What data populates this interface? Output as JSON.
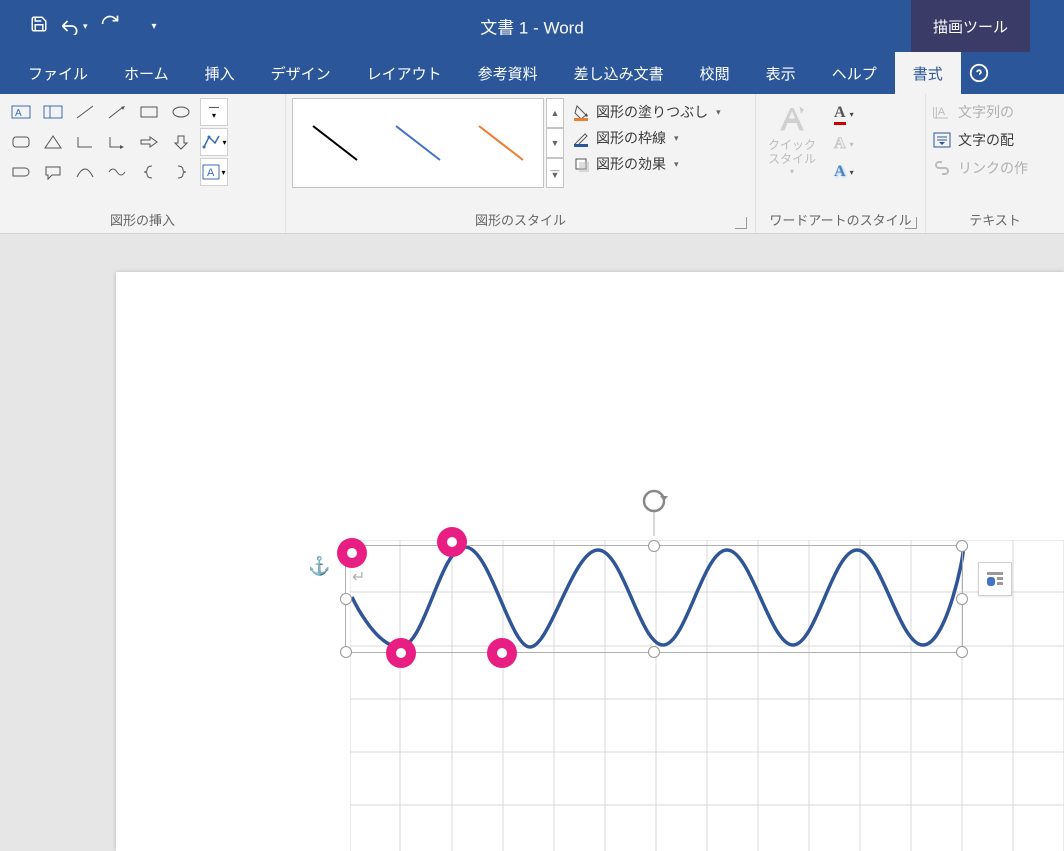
{
  "titlebar": {
    "doc_title": "文書 1",
    "app_name": "Word",
    "separator": " - ",
    "context_tab": "描画ツール"
  },
  "tabs": {
    "file": "ファイル",
    "home": "ホーム",
    "insert": "挿入",
    "design": "デザイン",
    "layout": "レイアウト",
    "references": "参考資料",
    "mailmerge": "差し込み文書",
    "review": "校閲",
    "view": "表示",
    "help": "ヘルプ",
    "format": "書式"
  },
  "groups": {
    "insert_shapes": "図形の挿入",
    "shape_styles": "図形のスタイル",
    "wordart_styles": "ワードアートのスタイル",
    "text": "テキスト"
  },
  "commands": {
    "shape_fill": "図形の塗りつぶし",
    "shape_outline": "図形の枠線",
    "shape_effects": "図形の効果",
    "quick_styles": "クイック\nスタイル",
    "text_direction": "文字列の",
    "align_text": "文字の配",
    "create_link": "リンクの作"
  }
}
